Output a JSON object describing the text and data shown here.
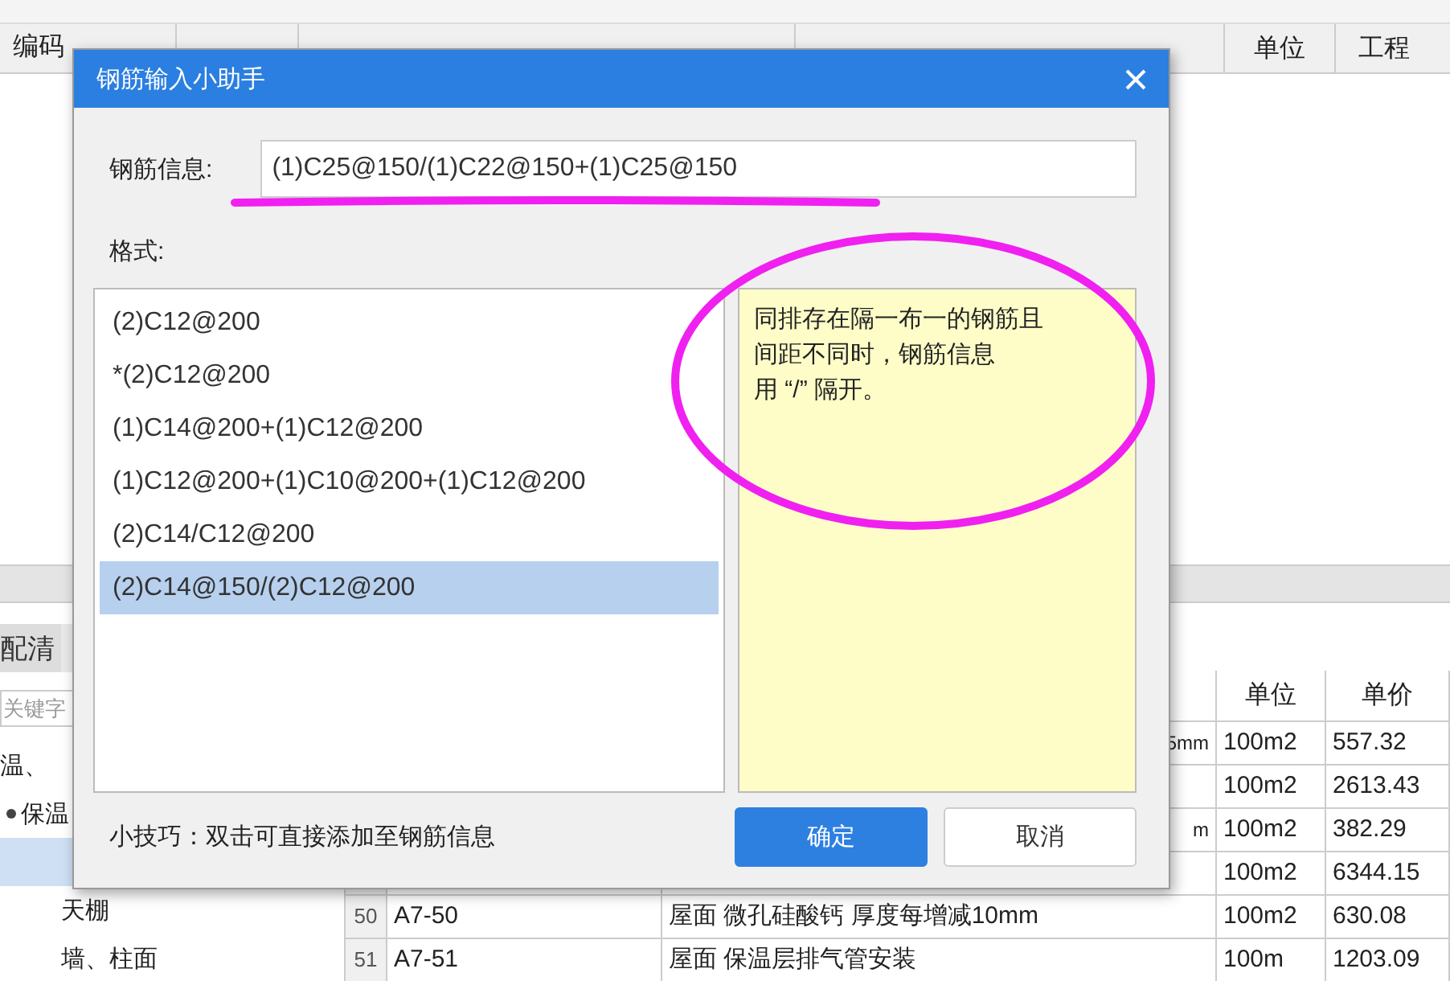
{
  "header": {
    "code": "编码",
    "unit": "单位",
    "project": "工程"
  },
  "left_panel": {
    "tab": "配清",
    "search": {
      "placeholder": "关键字"
    },
    "tree": [
      {
        "label": "温、",
        "selected": false,
        "children": [
          {
            "label": "保温",
            "expanded": true,
            "selected": false,
            "children": [
              {
                "selected": true
              },
              {
                "label": "天棚",
                "selected": false
              },
              {
                "label": "墙、柱面",
                "selected": false
              }
            ]
          }
        ]
      }
    ]
  },
  "table": {
    "columns": [
      "单位",
      "单价"
    ],
    "rows": [
      {
        "name": "5mm",
        "name_cut": true,
        "unit": "100m2",
        "price": "557.32"
      },
      {
        "unit": "100m2",
        "price": "2613.43"
      },
      {
        "name": "m",
        "name_cut": true,
        "unit": "100m2",
        "price": "382.29"
      },
      {
        "unit": "100m2",
        "price": "6344.15"
      },
      {
        "index": "50",
        "code": "A7-50",
        "name": "屋面 微孔硅酸钙 厚度每增减10mm",
        "name_cut": false,
        "unit": "100m2",
        "price": "630.08"
      },
      {
        "index": "51",
        "code": "A7-51",
        "name": "屋面 保温层排气管安装",
        "name_cut": false,
        "unit": "100m",
        "price": "1203.09"
      }
    ]
  },
  "dialog": {
    "title": "钢筋输入小助手",
    "field_label": "钢筋信息:",
    "field_value": "(1)C25@150/(1)C22@150+(1)C25@150",
    "format_label": "格式:",
    "formats": [
      {
        "text": "(2)C12@200",
        "selected": false
      },
      {
        "text": "*(2)C12@200",
        "selected": false
      },
      {
        "text": "(1)C14@200+(1)C12@200",
        "selected": false
      },
      {
        "text": "(1)C12@200+(1)C10@200+(1)C12@200",
        "selected": false
      },
      {
        "text": "(2)C14/C12@200",
        "selected": false
      },
      {
        "text": "(2)C14@150/(2)C12@200",
        "selected": true
      }
    ],
    "note_lines": [
      "同排存在隔一布一的钢筋且",
      "间距不同时，钢筋信息",
      "用 “/” 隔开。"
    ],
    "tip": "小技巧：双击可直接添加至钢筋信息",
    "buttons": [
      {
        "label": "确定",
        "kind": "primary"
      },
      {
        "label": "取消",
        "kind": "secondary"
      }
    ]
  },
  "annotations": {
    "underline": {
      "color": "#f020f0"
    },
    "ellipse": {
      "color": "#f020f0"
    }
  }
}
